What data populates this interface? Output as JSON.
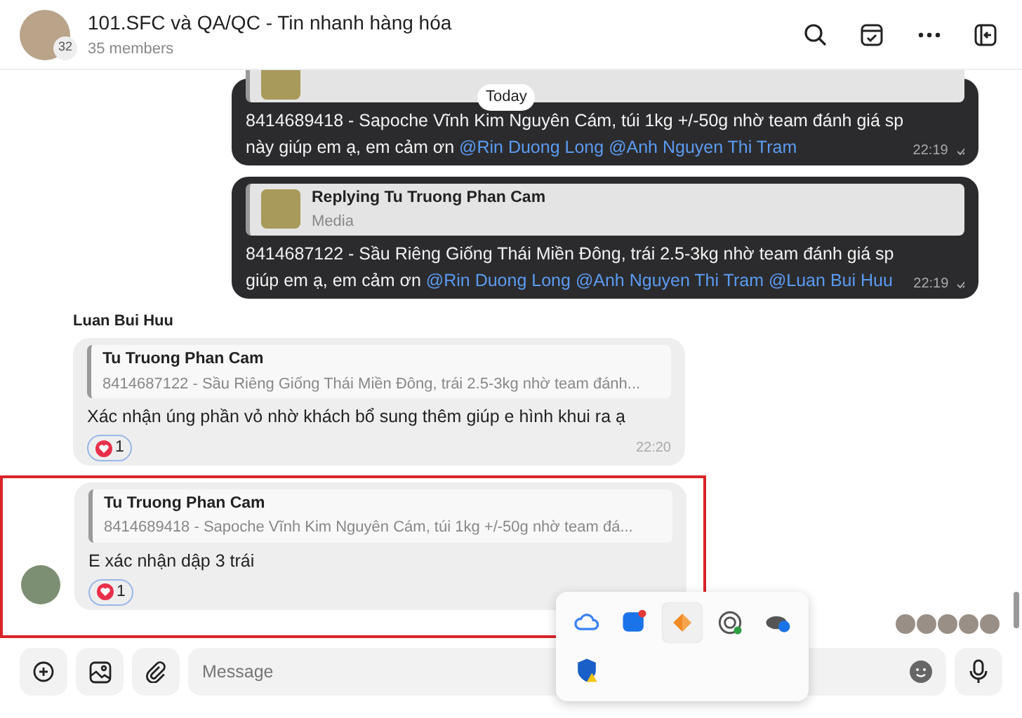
{
  "header": {
    "title": "101.SFC và QA/QC - Tin nhanh hàng hóa",
    "avatar_count": "32",
    "subtitle": "35 members"
  },
  "date_chip": "Today",
  "messages": [
    {
      "outgoing": true,
      "reply": {
        "thumbnail": true
      },
      "text": "8414689418 - Sapoche Vĩnh Kim Nguyên Cám, túi 1kg +/-50g nhờ team đánh giá sp này giúp em ạ, em cảm ơn",
      "mentions": [
        "@Rin Duong Long",
        "@Anh Nguyen Thi Tram"
      ],
      "time": "22:19",
      "read": true
    },
    {
      "outgoing": true,
      "reply": {
        "thumbnail": true,
        "title": "Replying Tu Truong Phan Cam",
        "subtitle": "Media"
      },
      "text": "8414687122 -   Sầu Riêng Giống Thái Miền Đông, trái 2.5-3kg nhờ team đánh giá sp giúp em ạ, em cảm ơn",
      "mentions": [
        "@Rin Duong Long",
        "@Anh Nguyen Thi Tram",
        "@Luan Bui Huu"
      ],
      "time": "22:19",
      "read": true
    },
    {
      "outgoing": false,
      "sender": "Luan Bui Huu",
      "reply": {
        "title": "Tu Truong Phan Cam",
        "subtitle": "8414687122 - Sầu Riêng Giống Thái Miền Đông, trái 2.5-3kg nhờ team đánh..."
      },
      "text": "Xác nhận úng phần vỏ nhờ khách bổ sung thêm giúp e hình khui ra ạ",
      "reaction": "1",
      "time": "22:20",
      "highlighted": false,
      "avatar": false
    },
    {
      "outgoing": false,
      "reply": {
        "title": "Tu Truong Phan Cam",
        "subtitle": "8414689418 - Sapoche Vĩnh Kim Nguyên Cám, túi 1kg +/-50g nhờ team đá..."
      },
      "text": "E xác nhận dập 3 trái",
      "reaction": "1",
      "highlighted": true,
      "avatar": true
    }
  ],
  "tray_icons": [
    {
      "kind": "cloud",
      "selected": false
    },
    {
      "kind": "chat",
      "selected": false
    },
    {
      "kind": "box",
      "selected": true
    },
    {
      "kind": "signal",
      "selected": false
    },
    {
      "kind": "sync",
      "selected": false
    },
    {
      "kind": "shield",
      "selected": false
    }
  ],
  "composer": {
    "placeholder": "Message"
  }
}
